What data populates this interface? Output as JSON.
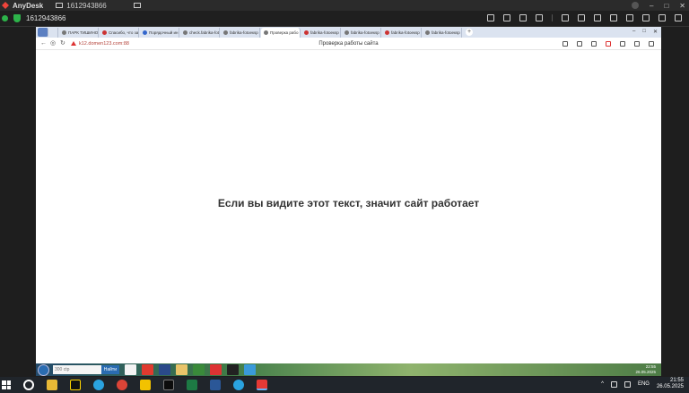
{
  "anydesk": {
    "app_name": "AnyDesk",
    "tab_id": "1612943866",
    "session_id": "1612943866",
    "minimize": "–",
    "maximize": "□",
    "close": "✕"
  },
  "browser": {
    "tabs": [
      {
        "label": "ПАРК ТИШИНО"
      },
      {
        "label": "Спасибо, что за"
      },
      {
        "label": "Порядочный ин"
      },
      {
        "label": "check.fabrika-fot"
      },
      {
        "label": "fabrika-fotoeкsp"
      },
      {
        "label": "Проверка рабо",
        "active": true
      },
      {
        "label": "fabrika-fotoeкsp"
      },
      {
        "label": "fabrika-fotoeкsp"
      },
      {
        "label": "fabrika-fotoeкsp"
      },
      {
        "label": "fabrika-fotoeкsp"
      }
    ],
    "new_tab": "+",
    "url": "k12.domen123.com:88",
    "page_title": "Проверка работы сайта",
    "win_min": "–",
    "win_max": "□",
    "win_close": "✕"
  },
  "page": {
    "heading": "Если вы видите этот текст, значит сайт работает"
  },
  "remote_taskbar": {
    "search_text": "300 ctp",
    "search_button": "Найти",
    "time": "22:55",
    "date": "26.05.2025"
  },
  "local_taskbar": {
    "lang": "ENG",
    "time": "21:55",
    "date": "26.05.2025"
  }
}
